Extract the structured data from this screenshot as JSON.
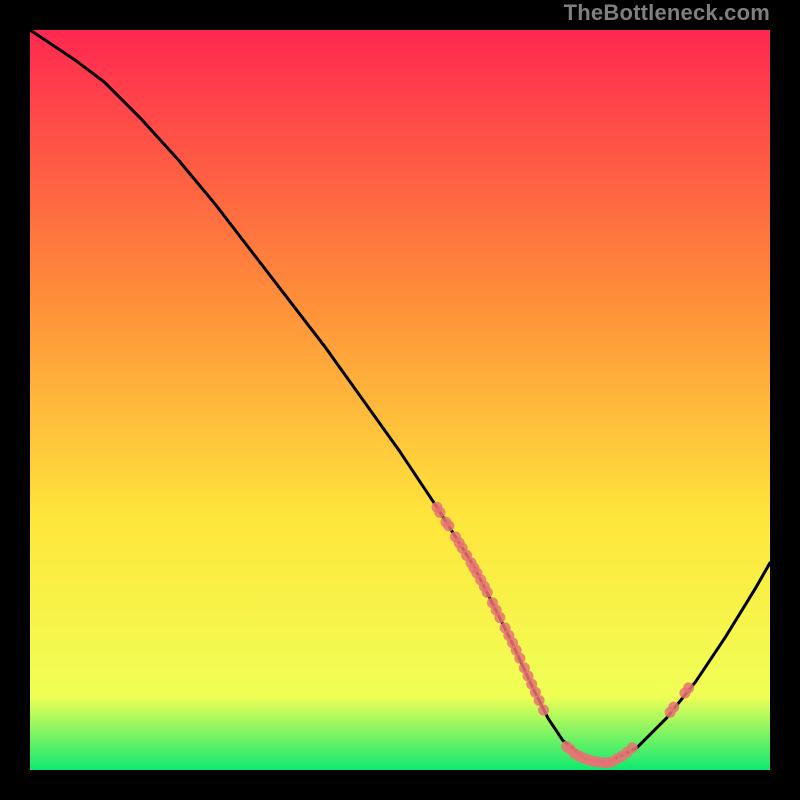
{
  "watermark": "TheBottleneck.com",
  "colors": {
    "background": "#000000",
    "curve": "#000000",
    "marker_fill": "#e87373",
    "gradient_top": "#ff2850",
    "gradient_mid1": "#ff8a3a",
    "gradient_mid2": "#ffe63c",
    "gradient_low": "#f0ff55",
    "gradient_bottom": "#10e970"
  },
  "chart_data": {
    "type": "line",
    "title": "",
    "xlabel": "",
    "ylabel": "",
    "xlim": [
      0,
      100
    ],
    "ylim": [
      0,
      100
    ],
    "curve": {
      "x": [
        0,
        3,
        6,
        10,
        15,
        20,
        25,
        30,
        35,
        40,
        45,
        50,
        55,
        60,
        62,
        65,
        68,
        70,
        72,
        75,
        78,
        82,
        86,
        90,
        94,
        98,
        100
      ],
      "y": [
        100,
        98,
        96,
        93,
        88,
        82.5,
        76.5,
        70,
        63.5,
        57,
        50,
        43,
        35.5,
        27.5,
        23.5,
        17.5,
        11,
        7,
        4,
        1.5,
        1,
        3,
        7,
        12,
        18,
        24.5,
        28
      ]
    },
    "markers": [
      {
        "x": 55.0,
        "y": 35.5
      },
      {
        "x": 55.4,
        "y": 34.8
      },
      {
        "x": 56.2,
        "y": 33.5
      },
      {
        "x": 56.6,
        "y": 33.0
      },
      {
        "x": 57.5,
        "y": 31.5
      },
      {
        "x": 58.0,
        "y": 30.7
      },
      {
        "x": 58.4,
        "y": 30.0
      },
      {
        "x": 59.0,
        "y": 29.0
      },
      {
        "x": 59.6,
        "y": 28.0
      },
      {
        "x": 60.0,
        "y": 27.3
      },
      {
        "x": 60.4,
        "y": 26.6
      },
      {
        "x": 60.9,
        "y": 25.7
      },
      {
        "x": 61.4,
        "y": 24.8
      },
      {
        "x": 61.8,
        "y": 24.0
      },
      {
        "x": 62.5,
        "y": 22.6
      },
      {
        "x": 63.0,
        "y": 21.6
      },
      {
        "x": 63.5,
        "y": 20.6
      },
      {
        "x": 64.2,
        "y": 19.2
      },
      {
        "x": 64.7,
        "y": 18.2
      },
      {
        "x": 65.2,
        "y": 17.2
      },
      {
        "x": 65.7,
        "y": 16.2
      },
      {
        "x": 66.2,
        "y": 15.1
      },
      {
        "x": 66.8,
        "y": 13.8
      },
      {
        "x": 67.3,
        "y": 12.7
      },
      {
        "x": 67.8,
        "y": 11.6
      },
      {
        "x": 68.3,
        "y": 10.5
      },
      {
        "x": 68.8,
        "y": 9.4
      },
      {
        "x": 69.4,
        "y": 8.1
      },
      {
        "x": 72.5,
        "y": 3.2
      },
      {
        "x": 73.0,
        "y": 2.8
      },
      {
        "x": 73.6,
        "y": 2.2
      },
      {
        "x": 74.2,
        "y": 1.9
      },
      {
        "x": 74.8,
        "y": 1.6
      },
      {
        "x": 75.4,
        "y": 1.4
      },
      {
        "x": 76.0,
        "y": 1.2
      },
      {
        "x": 76.6,
        "y": 1.1
      },
      {
        "x": 77.4,
        "y": 1.0
      },
      {
        "x": 78.0,
        "y": 1.0
      },
      {
        "x": 78.6,
        "y": 1.1
      },
      {
        "x": 79.3,
        "y": 1.5
      },
      {
        "x": 80.0,
        "y": 1.9
      },
      {
        "x": 80.7,
        "y": 2.4
      },
      {
        "x": 81.4,
        "y": 3.0
      },
      {
        "x": 86.5,
        "y": 7.8
      },
      {
        "x": 87.0,
        "y": 8.5
      },
      {
        "x": 88.5,
        "y": 10.4
      },
      {
        "x": 89.0,
        "y": 11.1
      }
    ]
  }
}
